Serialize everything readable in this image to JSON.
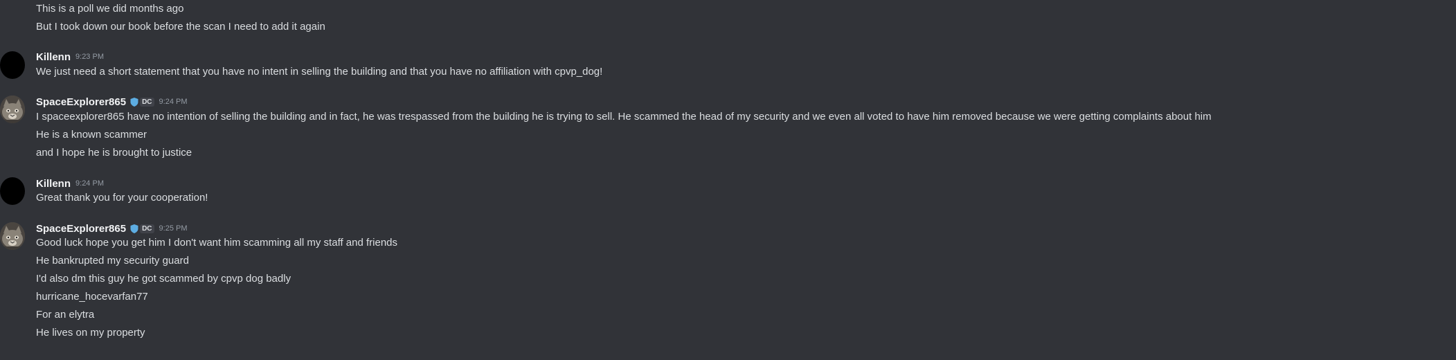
{
  "messages": [
    {
      "lines": [
        "This is a poll we did months ago",
        "But I took down our book before the scan I need to add it again"
      ]
    },
    {
      "author": "Killenn",
      "time": "9:23 PM",
      "avatar": "black-circle-avatar",
      "lines": [
        "We just need a short statement that you have no intent in selling the building and that you have no affiliation with cpvp_dog!"
      ]
    },
    {
      "author": "SpaceExplorer865",
      "tag": "DC",
      "time": "9:24 PM",
      "avatar": "cat-avatar",
      "lines": [
        "I spaceexplorer865 have no intention of selling the building and in fact, he was trespassed from the building he is trying to sell. He scammed the head of my security and we even all voted to have him removed because we were getting complaints about him",
        "He is a known scammer",
        "and I hope he is brought to justice"
      ]
    },
    {
      "author": "Killenn",
      "time": "9:24 PM",
      "avatar": "black-circle-avatar",
      "lines": [
        "Great thank you for your cooperation!"
      ]
    },
    {
      "author": "SpaceExplorer865",
      "tag": "DC",
      "time": "9:25 PM",
      "avatar": "cat-avatar",
      "lines": [
        "Good luck hope you get him I don't want him scamming all my staff and friends",
        "He bankrupted my security guard",
        "I'd also dm this guy he got scammed by cpvp dog badly",
        "hurricane_hocevarfan77",
        "For an elytra",
        "He lives on my property"
      ]
    }
  ],
  "colors": {
    "background": "#313338",
    "text": "#dbdee1",
    "username": "#f2f3f5",
    "timestamp": "#949ba4",
    "tag_shield": "#5dade2"
  }
}
